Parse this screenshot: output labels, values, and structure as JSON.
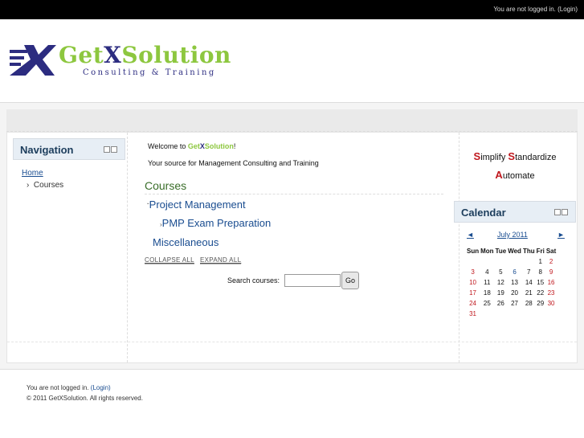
{
  "topbar": {
    "not_logged_in": "You are not logged in.",
    "login_link": "(Login)"
  },
  "logo": {
    "name_part1": "Get",
    "name_part2": "X",
    "name_part3": "Solution",
    "tagline": "Consulting & Training"
  },
  "navigation": {
    "title": "Navigation",
    "home": "Home",
    "courses": "Courses"
  },
  "main": {
    "welcome_prefix": "Welcome to ",
    "welcome_brand1": "Get",
    "welcome_brand2": "X",
    "welcome_brand3": "Solution",
    "welcome_suffix": "!",
    "subtitle": "Your source for Management Consulting and Training",
    "courses_heading": "Courses",
    "categories": [
      {
        "label": "Project Management",
        "toggle": "ˇ"
      },
      {
        "label": "PMP Exam Preparation",
        "toggle": "›"
      },
      {
        "label": "Miscellaneous"
      }
    ],
    "collapse_all": "COLLAPSE ALL",
    "expand_all": "EXPAND ALL",
    "search_label": "Search courses:",
    "search_value": "",
    "go_button": "Go"
  },
  "motto": {
    "w1_cap": "S",
    "w1_rest": "implify",
    "w2_cap": "S",
    "w2_rest": "tandardize",
    "w3_cap": "A",
    "w3_rest": "utomate"
  },
  "calendar": {
    "title": "Calendar",
    "prev": "◄",
    "next": "►",
    "month": "July 2011",
    "weekdays": [
      "Sun",
      "Mon",
      "Tue",
      "Wed",
      "Thu",
      "Fri",
      "Sat"
    ],
    "weeks": [
      [
        "",
        "",
        "",
        "",
        "",
        "1",
        "2"
      ],
      [
        "3",
        "4",
        "5",
        "6",
        "7",
        "8",
        "9"
      ],
      [
        "10",
        "11",
        "12",
        "13",
        "14",
        "15",
        "16"
      ],
      [
        "17",
        "18",
        "19",
        "20",
        "21",
        "22",
        "23"
      ],
      [
        "24",
        "25",
        "26",
        "27",
        "28",
        "29",
        "30"
      ],
      [
        "31",
        "",
        "",
        "",
        "",
        "",
        ""
      ]
    ],
    "event_day": "6",
    "weekend_color": "#c0181e",
    "link_color": "#1a4d90"
  },
  "footer": {
    "not_logged_in": "You are not logged in.",
    "login_link": "(Login)",
    "copyright": "© 2011 GetXSolution. All rights reserved."
  },
  "colors": {
    "brand_green": "#8dc73f",
    "brand_navy": "#2c2c80",
    "topbar": "#000000"
  }
}
